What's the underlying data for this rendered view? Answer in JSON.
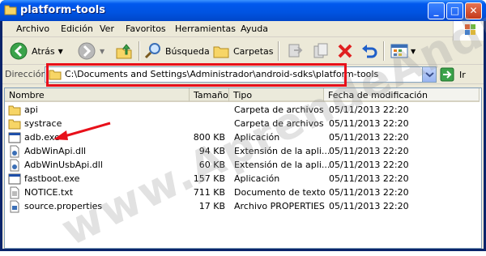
{
  "window": {
    "title": "platform-tools"
  },
  "menu": [
    "Archivo",
    "Edición",
    "Ver",
    "Favoritos",
    "Herramientas",
    "Ayuda"
  ],
  "toolbar": {
    "back_label": "Atrás",
    "search_label": "Búsqueda",
    "folders_label": "Carpetas"
  },
  "address": {
    "label": "Dirección",
    "path": "C:\\Documents and Settings\\Administrador\\android-sdks\\platform-tools",
    "go_label": "Ir"
  },
  "columns": {
    "name": "Nombre",
    "size": "Tamaño",
    "type": "Tipo",
    "modified": "Fecha de modificación"
  },
  "files": [
    {
      "icon": "folder-icon",
      "name": "api",
      "size": "",
      "type": "Carpeta de archivos",
      "modified": "05/11/2013 22:20"
    },
    {
      "icon": "folder-icon",
      "name": "systrace",
      "size": "",
      "type": "Carpeta de archivos",
      "modified": "05/11/2013 22:20"
    },
    {
      "icon": "exe-icon",
      "name": "adb.exe",
      "size": "800 KB",
      "type": "Aplicación",
      "modified": "05/11/2013 22:20"
    },
    {
      "icon": "dll-icon",
      "name": "AdbWinApi.dll",
      "size": "94 KB",
      "type": "Extensión de la apli...",
      "modified": "05/11/2013 22:20"
    },
    {
      "icon": "dll-icon",
      "name": "AdbWinUsbApi.dll",
      "size": "60 KB",
      "type": "Extensión de la apli...",
      "modified": "05/11/2013 22:20"
    },
    {
      "icon": "exe-icon",
      "name": "fastboot.exe",
      "size": "157 KB",
      "type": "Aplicación",
      "modified": "05/11/2013 22:20"
    },
    {
      "icon": "text-file-icon",
      "name": "NOTICE.txt",
      "size": "711 KB",
      "type": "Documento de texto",
      "modified": "05/11/2013 22:20"
    },
    {
      "icon": "properties-file-icon",
      "name": "source.properties",
      "size": "17 KB",
      "type": "Archivo PROPERTIES",
      "modified": "05/11/2013 22:20"
    }
  ],
  "watermark": "www.AprendeAndroid.com",
  "colors": {
    "highlight": "#e8101a",
    "title_bar": "#0058ee",
    "face": "#ece9d8"
  }
}
